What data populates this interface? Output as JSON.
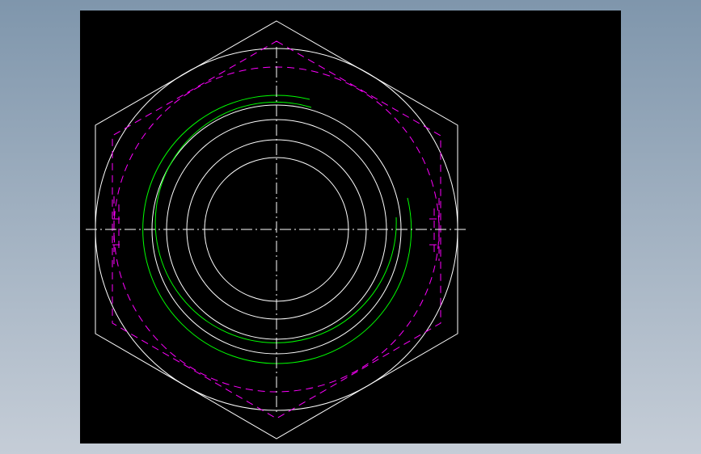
{
  "workspace": {
    "background_top": "#7f96ac",
    "background_bottom": "#c5cdd7"
  },
  "canvas": {
    "background": "#000000"
  },
  "drawing": {
    "title": "",
    "layers": [
      {
        "name": "outline",
        "color": "#ffffff",
        "linetype": "continuous"
      },
      {
        "name": "thread",
        "color": "#00ff00",
        "linetype": "continuous"
      },
      {
        "name": "hidden",
        "color": "#ff00ff",
        "linetype": "dashed"
      },
      {
        "name": "centerline",
        "color": "#ffffff",
        "linetype": "dash-dot"
      }
    ],
    "features": [
      {
        "name": "hex-outline",
        "layer": "outline"
      },
      {
        "name": "chamfer-circle",
        "layer": "outline"
      },
      {
        "name": "bore-circles",
        "layer": "outline",
        "count": 4
      },
      {
        "name": "thread-arcs",
        "layer": "thread",
        "count": 2
      },
      {
        "name": "hidden-hexagon",
        "layer": "hidden"
      },
      {
        "name": "hidden-circle",
        "layer": "hidden"
      },
      {
        "name": "center-lines",
        "layer": "centerline"
      }
    ]
  }
}
